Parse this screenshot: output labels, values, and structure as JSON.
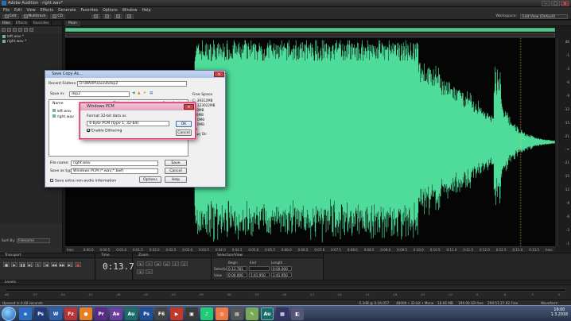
{
  "window": {
    "title": "Adobe Audition - right.wav*"
  },
  "menu": [
    "File",
    "Edit",
    "View",
    "Effects",
    "Generate",
    "Favorites",
    "Options",
    "Window",
    "Help"
  ],
  "toolbar": {
    "edit_label": "Edit",
    "multitrack_label": "Multitrack",
    "cd_label": "CD",
    "workspace_label": "Workspace:",
    "workspace_value": "Edit View (Default)"
  },
  "files_panel": {
    "tabs": [
      "Files",
      "Effects",
      "Favorites"
    ],
    "files": [
      "left.wav *",
      "right.wav *"
    ],
    "sort_label": "Sort By:",
    "sort_value": "Filename"
  },
  "editor": {
    "tab_label": "Main"
  },
  "db_ruler": [
    "dB",
    "-1",
    "-3",
    "-6",
    "-9",
    "-12",
    "-15",
    "-21",
    "-∞",
    "-21",
    "-15",
    "-12",
    "-9",
    "-6",
    "-3",
    "-1"
  ],
  "time_ruler": [
    "hms",
    "0:00.0",
    "0:00.5",
    "0:01.0",
    "0:01.5",
    "0:02.0",
    "0:02.5",
    "0:03.0",
    "0:03.5",
    "0:04.0",
    "0:04.5",
    "0:05.0",
    "0:05.5",
    "0:06.0",
    "0:06.5",
    "0:07.0",
    "0:07.5",
    "0:08.0",
    "0:08.5",
    "0:09.0",
    "0:09.5",
    "0:10.0",
    "0:10.5",
    "0:11.0",
    "0:11.5",
    "0:12.0",
    "0:12.5",
    "0:13.0",
    "0:13.5",
    "hms"
  ],
  "transport": {
    "title": "Transport"
  },
  "time": {
    "title": "Time",
    "value": "0:13.781"
  },
  "zoom": {
    "title": "Zoom"
  },
  "selection_view": {
    "title": "Selection/View",
    "col_begin": "Begin",
    "col_end": "End",
    "col_length": "Length",
    "row_selection": "Selection",
    "row_view": "View",
    "sel_begin": "0:13.781",
    "sel_end": "",
    "sel_length": "0:00.000",
    "view_begin": "0:00.000",
    "view_end": "1:41.950",
    "view_length": "1:41.950"
  },
  "levels": {
    "title": "Levels",
    "scale": [
      "dB",
      "-57",
      "-54",
      "-51",
      "-48",
      "-45",
      "-42",
      "-39",
      "-36",
      "-33",
      "-30",
      "-27",
      "-24",
      "-21",
      "-18",
      "-15",
      "-12",
      "-9",
      "-6",
      "-3",
      "0"
    ]
  },
  "status": {
    "left": "Opened in 0.48 seconds",
    "seg1": "-5.3dB @ 0:16.057",
    "seg2": "48000 • 32-bit • Mono",
    "seg3": "18.66 MB",
    "seg4": "199.90 GB free",
    "seg5": "299:51:27.92 Free",
    "seg6": "Waveform"
  },
  "save_dialog": {
    "title": "Save Copy As...",
    "recent_label": "Recent Folders:",
    "recent_value": "D:\\WARP\\sound\\dsp2",
    "savein_label": "Save in:",
    "savein_value": "dsp2",
    "col_name": "Name",
    "col_title": "Title",
    "col_contrib": "Contributing...",
    "files": [
      "left.wav",
      "right.wav"
    ],
    "free_space_label": "Free Space",
    "free_space": [
      "C:",
      "D:",
      "E:",
      "F:",
      "G:",
      "H:",
      "Fat"
    ],
    "free_space_values": [
      "39312MB",
      "123022MB",
      "0MB",
      "0MB",
      "0MB",
      "0MB",
      ""
    ],
    "free_space_extra": "Copy Dir",
    "filename_label": "File name:",
    "filename_value": "right.wav",
    "savetype_label": "Save as type:",
    "savetype_value": "Windows PCM (*.wav;*.bwf)",
    "extra_label": "Save extra non-audio information",
    "save_btn": "Save",
    "cancel_btn": "Cancel",
    "options_btn": "Options",
    "help_btn": "Help"
  },
  "pcm_dialog": {
    "title": "Windows PCM",
    "format_label": "Format 32-bit data as",
    "format_value": "4-byte PCM (type 1, 32-bit)",
    "dither_label": "Enable Dithering",
    "ok_btn": "OK",
    "cancel_btn": "Cancel"
  },
  "taskbar": {
    "apps": [
      "e",
      "Ps",
      "W",
      "Fz",
      "●",
      "Pr",
      "Ae",
      "Au",
      "Ps",
      "F6",
      "▶",
      "▣",
      "♪",
      "◎",
      "▤",
      "✎",
      "Au",
      "▦",
      "◧"
    ],
    "clock_time": "19:00",
    "clock_date": "1.3.2018"
  },
  "colors": {
    "waveform": "#4fdc9a",
    "accent": "#5cc090",
    "dialog_border": "#6b7d9a"
  }
}
